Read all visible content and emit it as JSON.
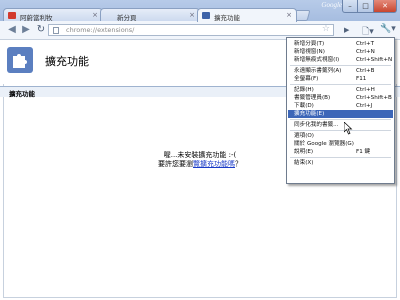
{
  "window": {
    "brand": "Google",
    "minimize_label": "–",
    "maximize_label": "□",
    "close_label": "✕"
  },
  "tabs": [
    {
      "label": "阿蔚當利牧",
      "icon": "gmail-favicon-icon",
      "active": false
    },
    {
      "label": "新分頁",
      "icon": "none",
      "active": false
    },
    {
      "label": "擴充功能",
      "icon": "extension-favicon-icon",
      "active": true
    }
  ],
  "tab_close_label": "×",
  "toolbar": {
    "back_icon": "back-arrow-icon",
    "forward_icon": "forward-arrow-icon",
    "reload_icon": "reload-icon",
    "url": "chrome://extensions/",
    "go_icon": "▶",
    "page_menu_icon": "page-menu-icon",
    "wrench_icon": "wrench-icon"
  },
  "page": {
    "title": "擴充功能",
    "section_title": "擴充功能",
    "empty_message": "喔...未安裝擴充功能 :-(",
    "browse_prefix": "要許您要瀏",
    "browse_link": "覽擴充功能嗎",
    "browse_suffix": "？"
  },
  "menu": {
    "groups": [
      [
        {
          "label": "新增分頁(T)",
          "shortcut": "Ctrl+T"
        },
        {
          "label": "新增視窗(N)",
          "shortcut": "Ctrl+N"
        },
        {
          "label": "新增無痕式視窗(I)",
          "shortcut": "Ctrl+Shift+N"
        }
      ],
      [
        {
          "label": "永遠顯示書籤列(A)",
          "shortcut": "Ctrl+B"
        },
        {
          "label": "全螢幕(F)",
          "shortcut": "F11"
        }
      ],
      [
        {
          "label": "記錄(H)",
          "shortcut": "Ctrl+H"
        },
        {
          "label": "書籤管理員(B)",
          "shortcut": "Ctrl+Shift+B"
        },
        {
          "label": "下載(D)",
          "shortcut": "Ctrl+J"
        },
        {
          "label": "擴充功能(E)",
          "shortcut": "",
          "highlighted": true
        }
      ],
      [
        {
          "label": "同步化我的書籤...",
          "shortcut": ""
        }
      ],
      [
        {
          "label": "選項(O)",
          "shortcut": ""
        },
        {
          "label": "關於 Google 瀏覽器(G)",
          "shortcut": ""
        },
        {
          "label": "說明(E)",
          "shortcut": "F1 鍵"
        }
      ],
      [
        {
          "label": "結束(X)",
          "shortcut": ""
        }
      ]
    ]
  },
  "colors": {
    "menu_highlight": "#3c66b8",
    "link": "#1a3bc7",
    "titlebar": "#b7cbe9"
  }
}
